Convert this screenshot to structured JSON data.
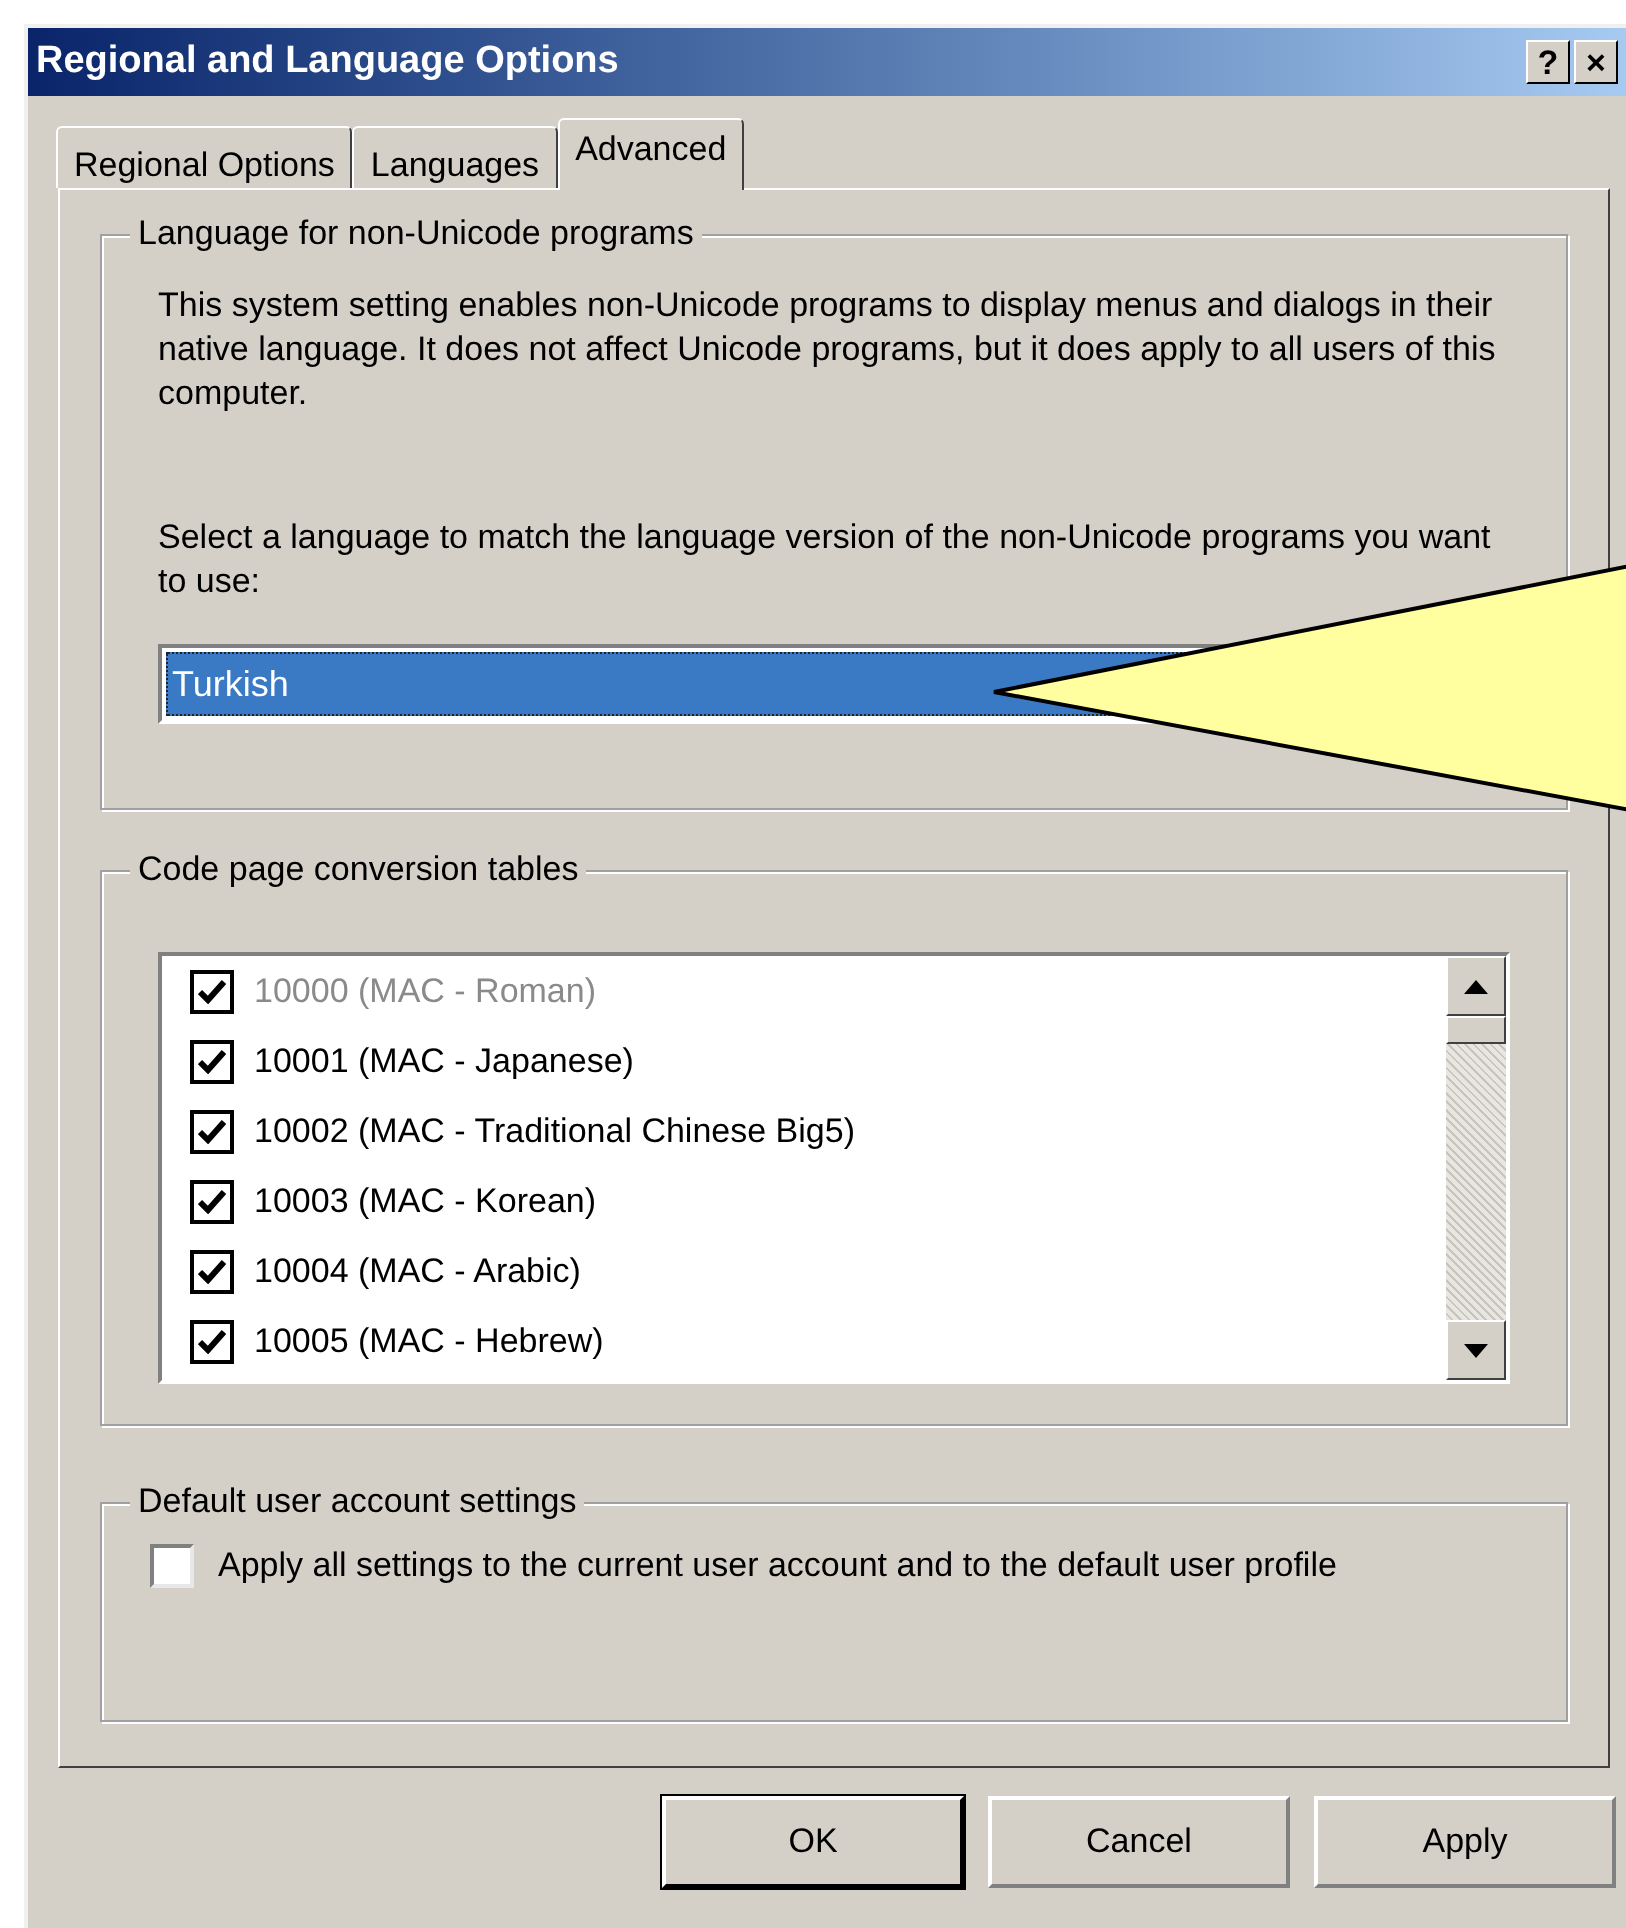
{
  "window": {
    "title": "Regional and Language Options",
    "title_buttons": [
      "?",
      "×"
    ]
  },
  "tabs": [
    {
      "label": "Regional Options",
      "selected": false
    },
    {
      "label": "Languages",
      "selected": false
    },
    {
      "label": "Advanced",
      "selected": true
    }
  ],
  "non_unicode": {
    "legend": "Language for non-Unicode programs",
    "description": "This system setting enables non-Unicode programs to display menus and dialogs in their native language. It does not affect Unicode programs, but it does apply to all users of this computer.",
    "prompt": "Select a language to match the language version of the non-Unicode programs you want to use:",
    "language": {
      "value": "Turkish",
      "selected": true
    }
  },
  "code_pages": {
    "legend": "Code page conversion tables",
    "items": [
      {
        "label": "10000 (MAC - Roman)",
        "checked": true,
        "disabled": true
      },
      {
        "label": "10001 (MAC - Japanese)",
        "checked": true,
        "disabled": false
      },
      {
        "label": "10002 (MAC - Traditional Chinese Big5)",
        "checked": true,
        "disabled": false
      },
      {
        "label": "10003 (MAC - Korean)",
        "checked": true,
        "disabled": false
      },
      {
        "label": "10004 (MAC - Arabic)",
        "checked": true,
        "disabled": false
      },
      {
        "label": "10005 (MAC - Hebrew)",
        "checked": true,
        "disabled": false
      }
    ]
  },
  "default_user": {
    "legend": "Default user account settings",
    "option": {
      "label": "Apply all settings to the current user account and to the default user profile",
      "checked": false
    }
  },
  "buttons": [
    {
      "label": "OK",
      "default": true
    },
    {
      "label": "Cancel",
      "default": false
    },
    {
      "label": "Apply",
      "default": false
    }
  ]
}
